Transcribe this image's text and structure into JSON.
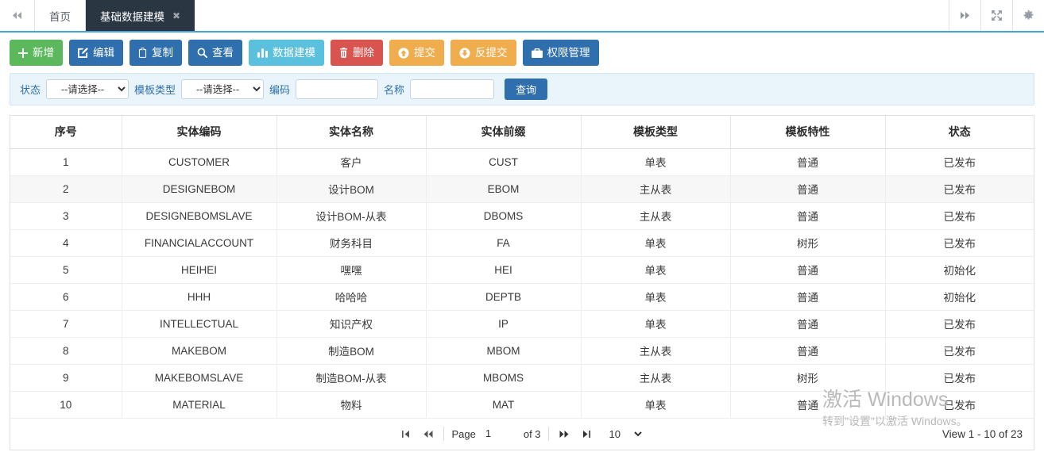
{
  "tabbar": {
    "nav_prev_icon": "double-chevron-left-icon",
    "tabs": [
      {
        "label": "首页",
        "active": false,
        "closable": false
      },
      {
        "label": "基础数据建模",
        "active": true,
        "closable": true,
        "close_glyph": "✖"
      }
    ],
    "right_icons": [
      {
        "name": "double-chevron-right-icon",
        "glyph": "▶▶"
      },
      {
        "name": "fullscreen-expand-icon",
        "glyph": "⤢"
      },
      {
        "name": "gear-icon",
        "glyph": "⚙"
      }
    ]
  },
  "toolbar": {
    "buttons": [
      {
        "label": "新增",
        "icon": "plus-icon",
        "color": "#5cb85c",
        "style": "green"
      },
      {
        "label": "编辑",
        "icon": "pencil-edit-icon",
        "color": "#2f6fad",
        "style": "blue"
      },
      {
        "label": "复制",
        "icon": "copy-icon",
        "color": "#2f6fad",
        "style": "blue"
      },
      {
        "label": "查看",
        "icon": "search-icon",
        "color": "#2f6fad",
        "style": "blue"
      },
      {
        "label": "数据建模",
        "icon": "bar-chart-icon",
        "color": "#5bc0de",
        "style": "lblue"
      },
      {
        "label": "删除",
        "icon": "trash-icon",
        "color": "#d9534f",
        "style": "red"
      },
      {
        "label": "提交",
        "icon": "arrow-up-circle-icon",
        "color": "#f0ad4e",
        "style": "orange"
      },
      {
        "label": "反提交",
        "icon": "arrow-down-circle-icon",
        "color": "#f0ad4e",
        "style": "orange"
      },
      {
        "label": "权限管理",
        "icon": "briefcase-icon",
        "color": "#2f6fad",
        "style": "blue"
      }
    ]
  },
  "filterbar": {
    "status_label": "状态",
    "status_value": "--请选择--",
    "status_options": [
      "--请选择--"
    ],
    "template_type_label": "模板类型",
    "template_type_value": "--请选择--",
    "template_type_options": [
      "--请选择--"
    ],
    "code_label": "编码",
    "code_value": "",
    "code_placeholder": "",
    "name_label": "名称",
    "name_value": "",
    "name_placeholder": "",
    "query_label": "查询"
  },
  "table": {
    "columns": [
      "序号",
      "实体编码",
      "实体名称",
      "实体前缀",
      "模板类型",
      "模板特性",
      "状态"
    ],
    "rows": [
      {
        "no": "1",
        "code": "CUSTOMER",
        "name": "客户",
        "prefix": "CUST",
        "type": "单表",
        "feature": "普通",
        "status": "已发布"
      },
      {
        "no": "2",
        "code": "DESIGNEBOM",
        "name": "设计BOM",
        "prefix": "EBOM",
        "type": "主从表",
        "feature": "普通",
        "status": "已发布"
      },
      {
        "no": "3",
        "code": "DESIGNEBOMSLAVE",
        "name": "设计BOM-从表",
        "prefix": "DBOMS",
        "type": "主从表",
        "feature": "普通",
        "status": "已发布"
      },
      {
        "no": "4",
        "code": "FINANCIALACCOUNT",
        "name": "财务科目",
        "prefix": "FA",
        "type": "单表",
        "feature": "树形",
        "status": "已发布"
      },
      {
        "no": "5",
        "code": "HEIHEI",
        "name": "嘿嘿",
        "prefix": "HEI",
        "type": "单表",
        "feature": "普通",
        "status": "初始化"
      },
      {
        "no": "6",
        "code": "HHH",
        "name": "哈哈哈",
        "prefix": "DEPTB",
        "type": "单表",
        "feature": "普通",
        "status": "初始化"
      },
      {
        "no": "7",
        "code": "INTELLECTUAL",
        "name": "知识产权",
        "prefix": "IP",
        "type": "单表",
        "feature": "普通",
        "status": "已发布"
      },
      {
        "no": "8",
        "code": "MAKEBOM",
        "name": "制造BOM",
        "prefix": "MBOM",
        "type": "主从表",
        "feature": "普通",
        "status": "已发布"
      },
      {
        "no": "9",
        "code": "MAKEBOMSLAVE",
        "name": "制造BOM-从表",
        "prefix": "MBOMS",
        "type": "主从表",
        "feature": "树形",
        "status": "已发布"
      },
      {
        "no": "10",
        "code": "MATERIAL",
        "name": "物料",
        "prefix": "MAT",
        "type": "单表",
        "feature": "普通",
        "status": "已发布"
      }
    ]
  },
  "pager": {
    "first_icon": "first-page-icon",
    "prev_icon": "prev-page-icon",
    "next_icon": "next-page-icon",
    "last_icon": "last-page-icon",
    "page_label": "Page",
    "page_value": "1",
    "of_label": "of 3",
    "page_size": "10",
    "page_size_options": [
      "10"
    ],
    "view_summary": "View 1 - 10 of 23"
  },
  "watermark": {
    "line1": "激活 Windows",
    "line2": "转到\"设置\"以激活 Windows。"
  }
}
